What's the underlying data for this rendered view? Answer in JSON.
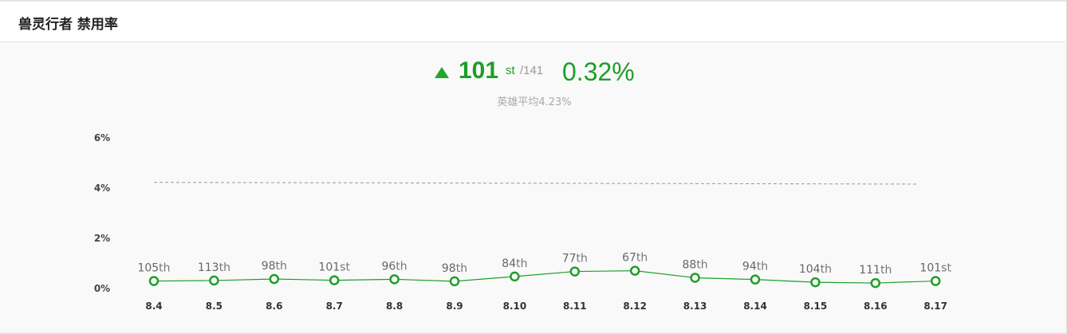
{
  "header": {
    "title": "兽灵行者 禁用率"
  },
  "summary": {
    "rank": "101",
    "rank_suffix": "st",
    "total": "/141",
    "rate": "0.32%",
    "trend": "up",
    "average_text": "英雄平均4.23%"
  },
  "colors": {
    "accent": "#1e9e28",
    "avg_line": "#999999",
    "header_bg": "#ffffff",
    "body_bg": "#f9f9f9"
  },
  "chart_data": {
    "type": "line",
    "title": "",
    "xlabel": "",
    "ylabel": "",
    "ylim": [
      0,
      6
    ],
    "yticks": [
      "6%",
      "4%",
      "2%",
      "0%"
    ],
    "ytick_values": [
      6,
      4,
      2,
      0
    ],
    "grid": false,
    "categories": [
      "8.4",
      "8.5",
      "8.6",
      "8.7",
      "8.8",
      "8.9",
      "8.10",
      "8.11",
      "8.12",
      "8.13",
      "8.14",
      "8.15",
      "8.16",
      "8.17"
    ],
    "series": [
      {
        "values": [
          0.3,
          0.32,
          0.38,
          0.33,
          0.37,
          0.29,
          0.48,
          0.68,
          0.71,
          0.43,
          0.36,
          0.25,
          0.22,
          0.3
        ]
      }
    ],
    "ranks": [
      "105",
      "113",
      "98",
      "101",
      "96",
      "98",
      "84",
      "77",
      "67",
      "88",
      "94",
      "104",
      "111",
      "101"
    ],
    "rank_suffixes": [
      "th",
      "th",
      "th",
      "st",
      "th",
      "th",
      "th",
      "th",
      "th",
      "th",
      "th",
      "th",
      "th",
      "st"
    ],
    "average_line": [
      4.23,
      4.16
    ]
  }
}
